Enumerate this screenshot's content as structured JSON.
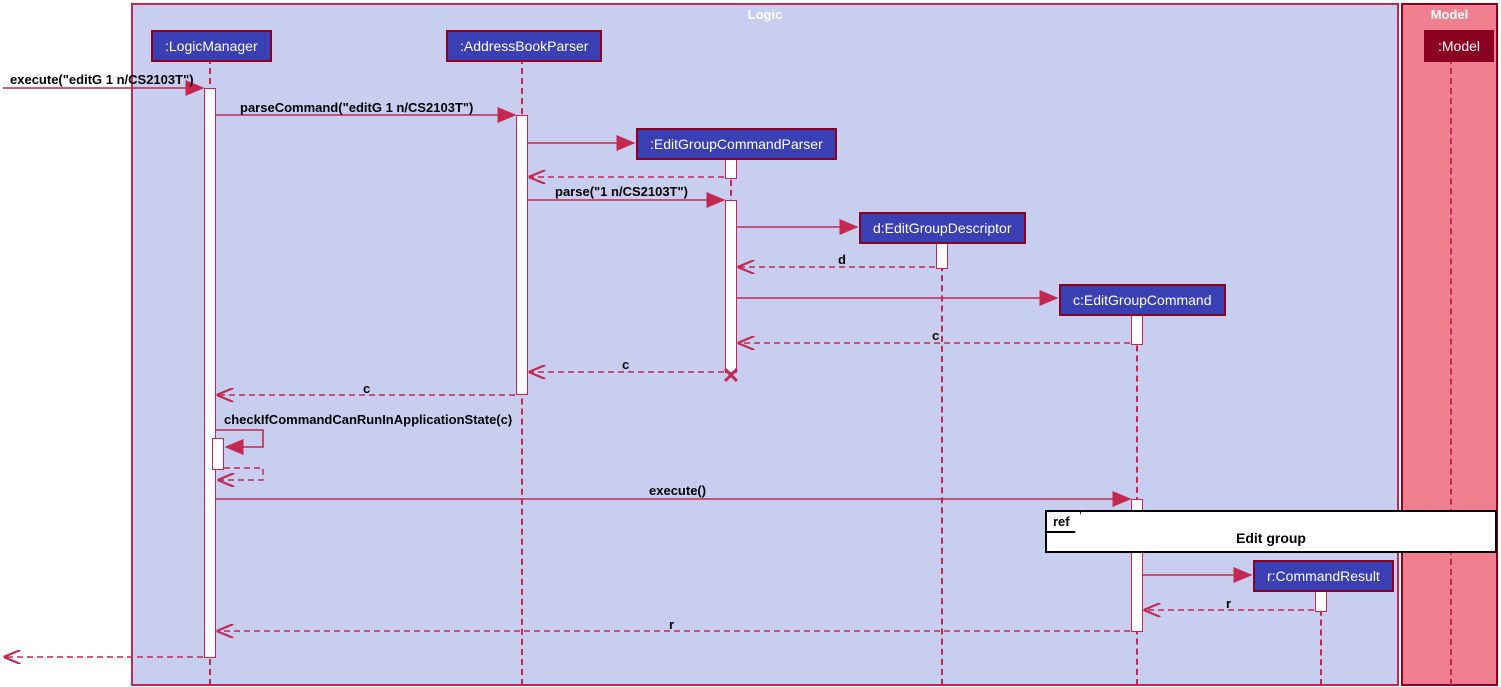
{
  "frames": {
    "logic": "Logic",
    "model": "Model"
  },
  "participants": {
    "logicManager": ":LogicManager",
    "addressBookParser": ":AddressBookParser",
    "editGroupCommandParser": ":EditGroupCommandParser",
    "editGroupDescriptor": "d:EditGroupDescriptor",
    "editGroupCommand": "c:EditGroupCommand",
    "commandResult": "r:CommandResult",
    "model": ":Model"
  },
  "messages": {
    "execute_in": "execute(\"editG 1 n/CS2103T\")",
    "parseCommand": "parseCommand(\"editG 1 n/CS2103T\")",
    "parse": "parse(\"1 n/CS2103T\")",
    "return_d": "d",
    "return_c_parser": "c",
    "return_c_abp": "c",
    "return_c_lm": "c",
    "checkIf": "checkIfCommandCanRunInApplicationState(c)",
    "execute2": "execute()",
    "return_r": "r",
    "return_r_lm": "r"
  },
  "ref": {
    "tab": "ref",
    "label": "Edit group"
  }
}
